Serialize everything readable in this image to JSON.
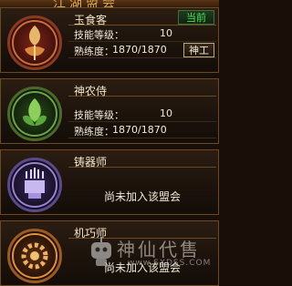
{
  "header": {
    "title": "江湖盟会"
  },
  "guilds": [
    {
      "name": "玉食客",
      "badge": "当前",
      "skill_label": "技能等级：",
      "skill_level": "10",
      "prof_label": "熟练度：",
      "proficiency": "1870/1870",
      "action": "神工",
      "icon": "phoenix-emblem-icon",
      "color": "#b2402a"
    },
    {
      "name": "神农侍",
      "skill_label": "技能等级：",
      "skill_level": "10",
      "prof_label": "熟练度：",
      "proficiency": "1870/1870",
      "icon": "herb-leaf-emblem-icon",
      "color": "#4a9a3a"
    },
    {
      "name": "铸器师",
      "status": "尚未加入该盟会",
      "icon": "forge-emblem-icon",
      "color": "#7a5ab0"
    },
    {
      "name": "机巧师",
      "status": "尚未加入该盟会",
      "icon": "gear-emblem-icon",
      "color": "#d07a2a"
    }
  ],
  "watermark": {
    "text": "神仙代售",
    "url": "www.SXDSS.COM"
  }
}
